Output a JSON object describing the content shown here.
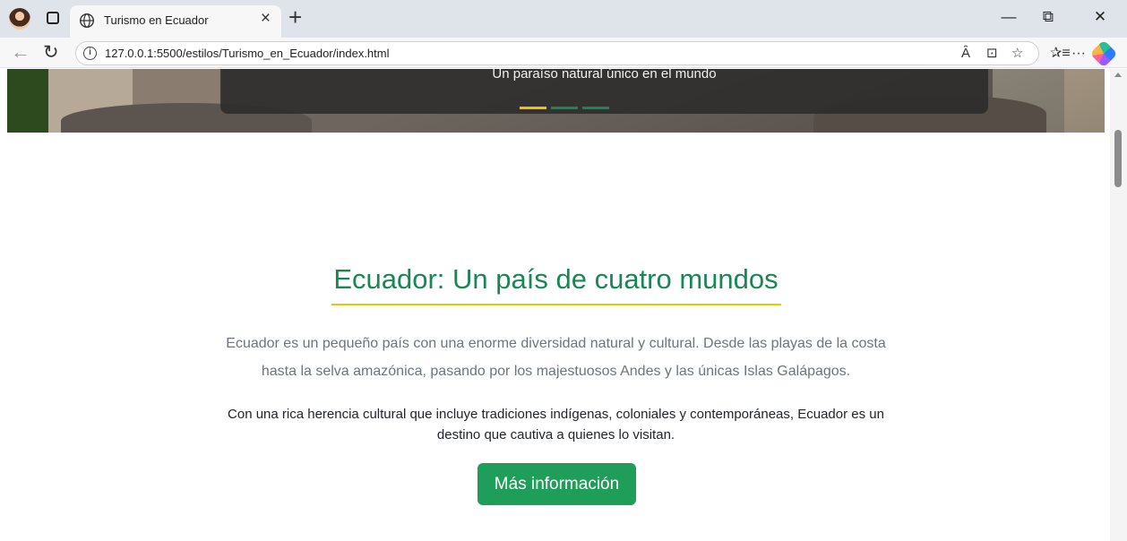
{
  "browser": {
    "tab_title": "Turismo en Ecuador",
    "tab_close": "×",
    "new_tab": "+",
    "url": "127.0.0.1:5500/estilos/Turismo_en_Ecuador/index.html",
    "window": {
      "minimize": "—",
      "restore": "⧉",
      "close": "✕"
    },
    "nav": {
      "back": "←",
      "reload": "↻"
    },
    "url_actions": {
      "read_aloud": "Ȃ",
      "immersive": "⊡",
      "favorite": "☆"
    },
    "toolbar": {
      "favorites": "✰≡",
      "more": "···"
    },
    "icons": [
      "avatar",
      "tab-actions-icon",
      "globe-icon",
      "info-icon",
      "read-aloud-icon",
      "immersive-reader-icon",
      "favorite-star-icon",
      "favorites-icon",
      "more-icon",
      "copilot-icon"
    ]
  },
  "hero": {
    "caption": "Un paraíso natural único en el mundo",
    "indicators": [
      {
        "color": "#f2c200",
        "active": true
      },
      {
        "color": "#198754",
        "active": false
      },
      {
        "color": "#198754",
        "active": false
      }
    ]
  },
  "main": {
    "title": "Ecuador: Un país de cuatro mundos",
    "lead": "Ecuador es un pequeño país con una enorme diversidad natural y cultural. Desde las playas de la costa hasta la selva amazónica, pasando por los majestuosos Andes y las únicas Islas Galápagos.",
    "paragraph": "Con una rica herencia cultural que incluye tradiciones indígenas, coloniales y contemporáneas, Ecuador es un destino que cautiva a quienes lo visitan.",
    "button": "Más información"
  },
  "colors": {
    "primary_green": "#198754",
    "button_green": "#1f9e5a",
    "accent_yellow": "#f2c200",
    "muted_text": "#6c757d"
  }
}
